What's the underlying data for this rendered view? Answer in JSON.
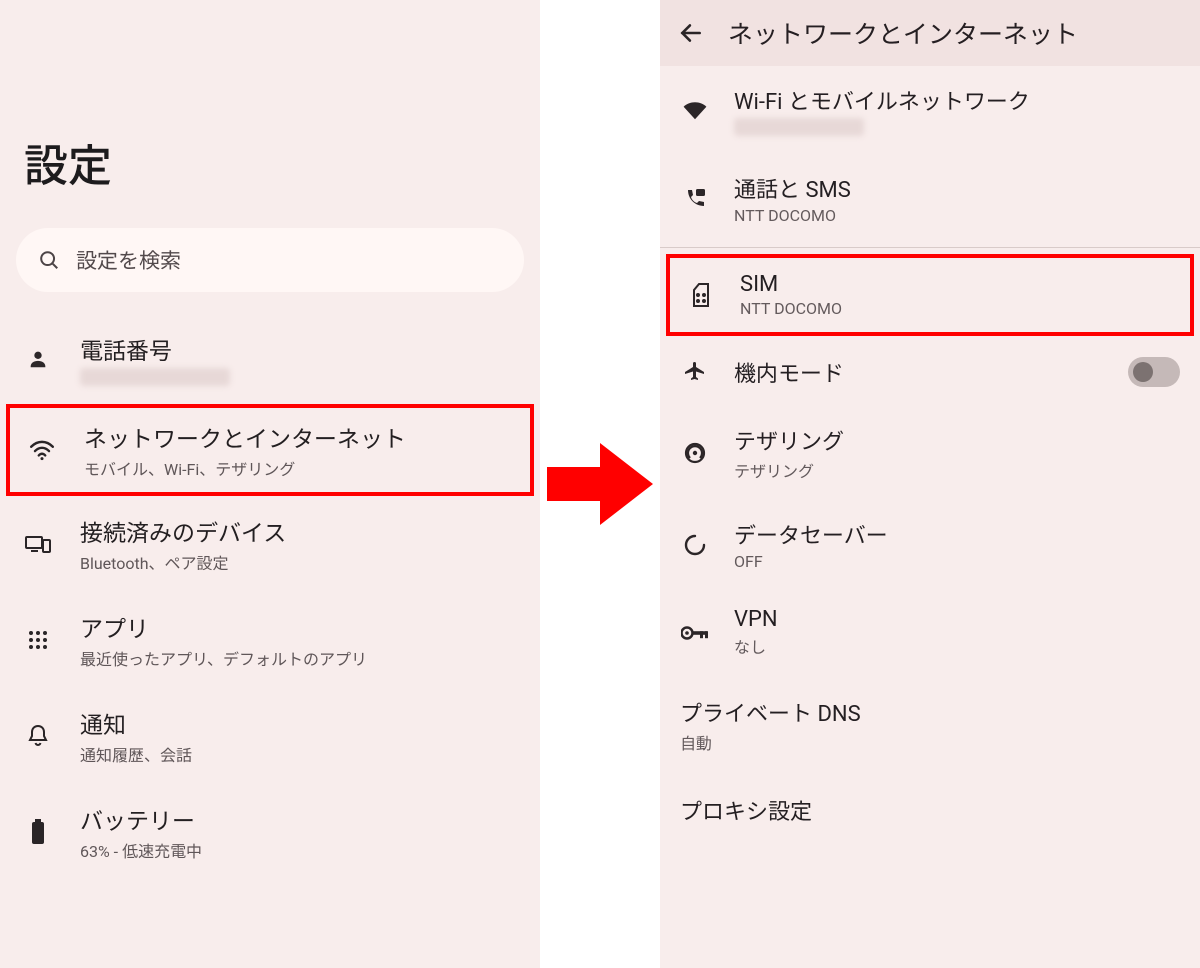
{
  "left": {
    "title": "設定",
    "search_placeholder": "設定を検索",
    "items": {
      "phone": {
        "label": "電話番号"
      },
      "network": {
        "label": "ネットワークとインターネット",
        "sub": "モバイル、Wi-Fi、テザリング"
      },
      "devices": {
        "label": "接続済みのデバイス",
        "sub": "Bluetooth、ペア設定"
      },
      "apps": {
        "label": "アプリ",
        "sub": "最近使ったアプリ、デフォルトのアプリ"
      },
      "notif": {
        "label": "通知",
        "sub": "通知履歴、会話"
      },
      "battery": {
        "label": "バッテリー",
        "sub": "63% - 低速充電中"
      }
    }
  },
  "right": {
    "title": "ネットワークとインターネット",
    "items": {
      "wifi": {
        "label": "Wi-Fi とモバイルネットワーク"
      },
      "calls": {
        "label": "通話と SMS",
        "sub": "NTT DOCOMO"
      },
      "sim": {
        "label": "SIM",
        "sub": "NTT DOCOMO"
      },
      "airplane": {
        "label": "機内モード"
      },
      "tether": {
        "label": "テザリング",
        "sub": "テザリング"
      },
      "datasaver": {
        "label": "データセーバー",
        "sub": "OFF"
      },
      "vpn": {
        "label": "VPN",
        "sub": "なし"
      },
      "pdns": {
        "label": "プライベート DNS",
        "sub": "自動"
      },
      "proxy": {
        "label": "プロキシ設定"
      }
    }
  }
}
